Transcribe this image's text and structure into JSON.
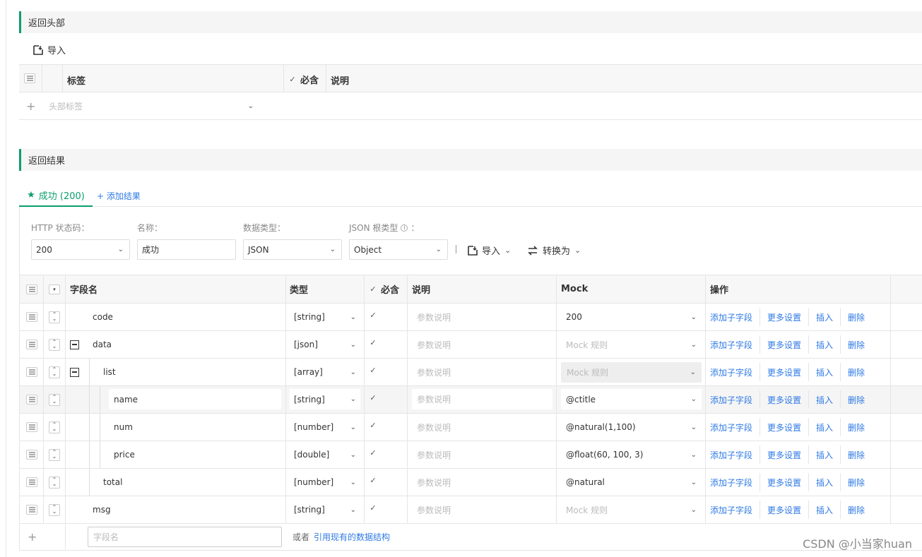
{
  "header_section": {
    "title": "返回头部",
    "import_label": "导入",
    "table_headers": {
      "tag": "标签",
      "required": "必含",
      "desc": "说明"
    },
    "new_row_placeholder": "头部标签"
  },
  "result_section": {
    "title": "返回结果",
    "tabs": [
      {
        "label": "成功 (200)"
      }
    ],
    "add_result_label": "+ 添加结果",
    "form": {
      "http_status_label": "HTTP 状态码：",
      "http_status_value": "200",
      "name_label": "名称：",
      "name_value": "成功",
      "data_type_label": "数据类型：",
      "data_type_value": "JSON",
      "json_root_label": "JSON 根类型",
      "json_root_colon": "：",
      "json_root_value": "Object",
      "import_label": "导入",
      "convert_label": "转换为"
    },
    "grid_headers": {
      "field": "字段名",
      "type": "类型",
      "required": "必含",
      "desc": "说明",
      "mock": "Mock",
      "ops": "操作"
    },
    "desc_placeholder": "参数说明",
    "mock_placeholder": "Mock 规则",
    "ops": {
      "add_child": "添加子字段",
      "more": "更多设置",
      "insert": "插入",
      "delete": "删除"
    },
    "rows": [
      {
        "field": "code",
        "type": "[string]",
        "mock": "200"
      },
      {
        "field": "data",
        "type": "[json]",
        "mock": ""
      },
      {
        "field": "list",
        "type": "[array]",
        "mock": ""
      },
      {
        "field": "name",
        "type": "[string]",
        "mock": "@ctitle"
      },
      {
        "field": "num",
        "type": "[number]",
        "mock": "@natural(1,100)"
      },
      {
        "field": "price",
        "type": "[double]",
        "mock": "@float(60, 100, 3)"
      },
      {
        "field": "total",
        "type": "[number]",
        "mock": "@natural"
      },
      {
        "field": "msg",
        "type": "[string]",
        "mock": ""
      }
    ],
    "new_field_placeholder": "字段名",
    "or_label": "或者",
    "ref_link": "引用现有的数据结构"
  },
  "watermark": "CSDN @小当家huan",
  "colors": {
    "accent": "#0b9e6e",
    "link": "#2f7ae5"
  },
  "icons": [
    "import-icon",
    "menu-icon",
    "check-icon",
    "plus-icon",
    "chevron-down-icon",
    "star-icon",
    "info-icon",
    "convert-icon",
    "sort-icon",
    "collapse-icon"
  ]
}
